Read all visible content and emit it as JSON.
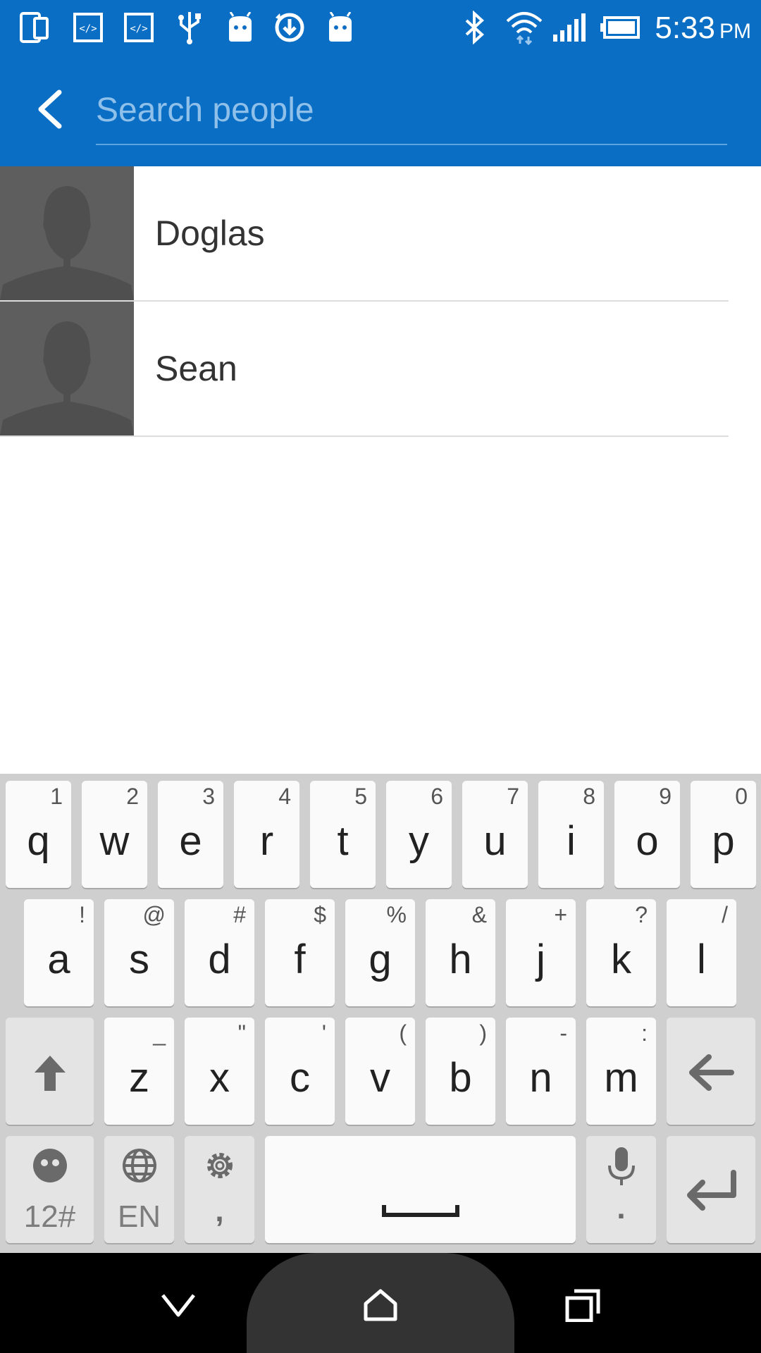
{
  "status_bar": {
    "icons": [
      "phone-tablet-icon",
      "code-icon",
      "code-icon",
      "usb-icon",
      "android-icon",
      "sync-download-icon",
      "android-icon",
      "bluetooth-icon",
      "wifi-icon",
      "signal-icon",
      "battery-icon"
    ],
    "time": "5:33",
    "ampm": "PM"
  },
  "app_bar": {
    "back_icon": "chevron-left-icon",
    "search_placeholder": "Search people",
    "search_value": ""
  },
  "contacts": [
    {
      "name": "Doglas",
      "avatar": "default-person-avatar"
    },
    {
      "name": "Sean",
      "avatar": "default-person-avatar"
    }
  ],
  "keyboard": {
    "row1": [
      {
        "key": "q",
        "alt": "1"
      },
      {
        "key": "w",
        "alt": "2"
      },
      {
        "key": "e",
        "alt": "3"
      },
      {
        "key": "r",
        "alt": "4"
      },
      {
        "key": "t",
        "alt": "5"
      },
      {
        "key": "y",
        "alt": "6"
      },
      {
        "key": "u",
        "alt": "7"
      },
      {
        "key": "i",
        "alt": "8"
      },
      {
        "key": "o",
        "alt": "9"
      },
      {
        "key": "p",
        "alt": "0"
      }
    ],
    "row2": [
      {
        "key": "a",
        "alt": "!"
      },
      {
        "key": "s",
        "alt": "@"
      },
      {
        "key": "d",
        "alt": "#"
      },
      {
        "key": "f",
        "alt": "$"
      },
      {
        "key": "g",
        "alt": "%"
      },
      {
        "key": "h",
        "alt": "&"
      },
      {
        "key": "j",
        "alt": "+"
      },
      {
        "key": "k",
        "alt": "?"
      },
      {
        "key": "l",
        "alt": "/"
      }
    ],
    "row3": [
      {
        "key": "z",
        "alt": "_"
      },
      {
        "key": "x",
        "alt": "\""
      },
      {
        "key": "c",
        "alt": "'"
      },
      {
        "key": "v",
        "alt": "("
      },
      {
        "key": "b",
        "alt": ")"
      },
      {
        "key": "n",
        "alt": "-"
      },
      {
        "key": "m",
        "alt": ":"
      }
    ],
    "shift_icon": "shift-arrow-up-icon",
    "backspace_icon": "backspace-arrow-left-icon",
    "symbols_label": "12#",
    "emoji_icon": "emoji-face-icon",
    "language_label": "EN",
    "globe_icon": "globe-icon",
    "settings_icon": "gear-icon",
    "comma_label": ",",
    "space_icon": "space-bar-icon",
    "mic_icon": "microphone-icon",
    "period_label": ".",
    "enter_icon": "enter-return-icon"
  },
  "nav_bar": {
    "back_icon": "chevron-down-icon",
    "home_icon": "home-icon",
    "recents_icon": "recents-icon"
  },
  "colors": {
    "primary": "#0a6ec5",
    "placeholder": "#8fc0ea",
    "avatar_bg": "#5e5e5e",
    "keyboard_bg": "#cfcfcf"
  }
}
